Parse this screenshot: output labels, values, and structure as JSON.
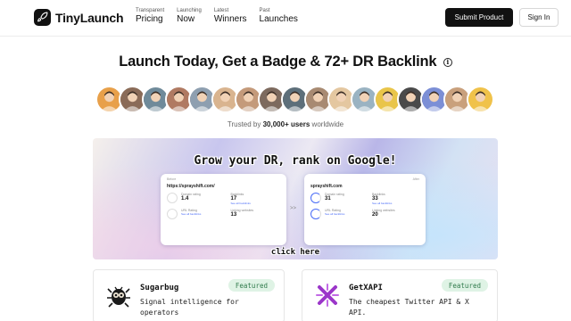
{
  "brand": {
    "name": "TinyLaunch",
    "logo_icon": "rocket-icon"
  },
  "nav": [
    {
      "kicker": "Transparent",
      "label": "Pricing"
    },
    {
      "kicker": "Launching",
      "label": "Now"
    },
    {
      "kicker": "Latest",
      "label": "Winners"
    },
    {
      "kicker": "Past",
      "label": "Launches"
    }
  ],
  "actions": {
    "submit_label": "Submit Product",
    "signin_label": "Sign In"
  },
  "hero": {
    "title": "Launch Today, Get a Badge & 72+ DR Backlink",
    "info_icon": "info-icon",
    "trusted_prefix": "Trusted by",
    "trusted_count": "30,000+ users",
    "trusted_suffix": "worldwide"
  },
  "avatars": {
    "count": 17,
    "colors": [
      "#e8a04a",
      "#8a6b58",
      "#6f8a9a",
      "#b07a62",
      "#8e9fb0",
      "#d9b48f",
      "#c49a7a",
      "#7d6a5e",
      "#5d6f7a",
      "#a88a72",
      "#e4c7a0",
      "#9ab3c2",
      "#e9c54a",
      "#4a4a4a",
      "#7c8fd6",
      "#c9a07c",
      "#f0c24a"
    ]
  },
  "banner": {
    "headline": "Grow your DR, rank on Google!",
    "cta": "click here",
    "before": {
      "tag": "Before",
      "url": "https://sprayshift.com/",
      "dr_label": "Domain rating",
      "dr_value": "1.4",
      "backlinks_label": "Backlinks",
      "backlinks_value": "17",
      "refd_label": "Linking websites",
      "refd_value": "13",
      "ur_label": "URL Rating",
      "link_text": "See all backlinks"
    },
    "after": {
      "tag": "After",
      "url": "sprayshift.com",
      "dr_label": "Domain rating",
      "dr_value": "31",
      "backlinks_label": "Backlinks",
      "backlinks_value": "33",
      "refd_label": "Linking websites",
      "refd_value": "20",
      "ur_label": "URL Rating",
      "link_text": "See all backlinks"
    }
  },
  "cards": [
    {
      "name": "Sugarbug",
      "desc": "Signal intelligence for operators",
      "badge": "Featured",
      "logo_icon": "sugarbug-logo-icon"
    },
    {
      "name": "GetXAPI",
      "desc": "The cheapest Twitter API & X API.",
      "badge": "Featured",
      "logo_icon": "getxapi-logo-icon"
    }
  ]
}
